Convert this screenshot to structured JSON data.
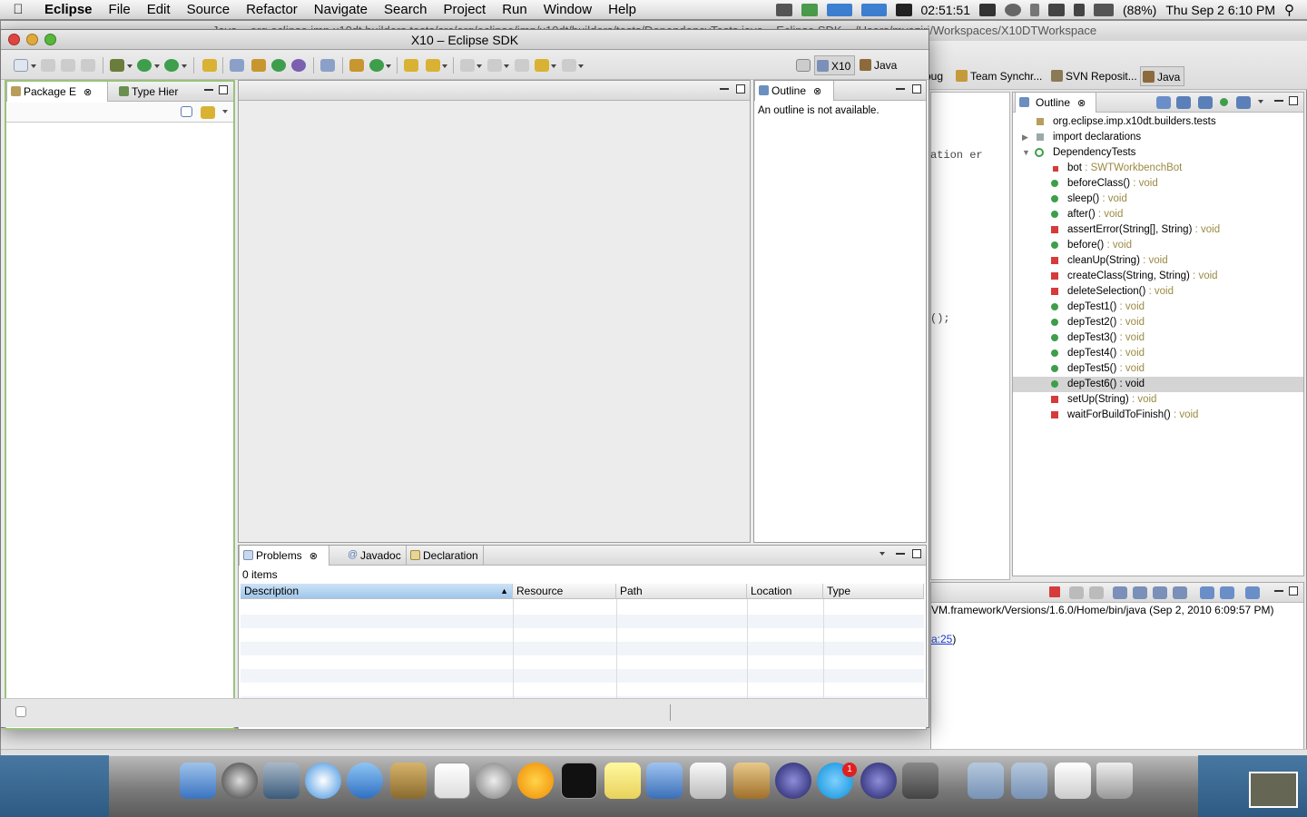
{
  "menubar": {
    "app_name": "Eclipse",
    "items": [
      "File",
      "Edit",
      "Source",
      "Refactor",
      "Navigate",
      "Search",
      "Project",
      "Run",
      "Window",
      "Help"
    ],
    "clock_text": "02:51:51",
    "battery": "(88%)",
    "datetime": "Thu Sep 2  6:10 PM"
  },
  "back_window": {
    "title": "Java – org.eclipse.imp.x10dt.builders.tests/src/org/eclipse/imp/x10dt/builders/tests/DependencyTests.java – Eclipse SDK – /Users/mvaziri/Workspaces/X10DTWorkspace",
    "perspectives": [
      "bug",
      "Team Synchr...",
      "SVN Reposit...",
      "Java"
    ],
    "code_lines": [
      "ation er",
      "();"
    ],
    "outline": {
      "tab": "Outline",
      "items": [
        {
          "label": "org.eclipse.imp.x10dt.builders.tests",
          "type": ""
        },
        {
          "label": "import declarations",
          "type": ""
        },
        {
          "label": "DependencyTests",
          "type": ""
        },
        {
          "label": "bot",
          "type": " : SWTWorkbenchBot"
        },
        {
          "label": "beforeClass()",
          "type": " : void"
        },
        {
          "label": "sleep()",
          "type": " : void"
        },
        {
          "label": "after()",
          "type": " : void"
        },
        {
          "label": "assertError(String[], String)",
          "type": " : void"
        },
        {
          "label": "before()",
          "type": " : void"
        },
        {
          "label": "cleanUp(String)",
          "type": " : void"
        },
        {
          "label": "createClass(String, String)",
          "type": " : void"
        },
        {
          "label": "deleteSelection()",
          "type": " : void"
        },
        {
          "label": "depTest1()",
          "type": " : void"
        },
        {
          "label": "depTest2()",
          "type": " : void"
        },
        {
          "label": "depTest3()",
          "type": " : void"
        },
        {
          "label": "depTest4()",
          "type": " : void"
        },
        {
          "label": "depTest5()",
          "type": " : void"
        },
        {
          "label": "depTest6()",
          "type": " : void"
        },
        {
          "label": "setUp(String)",
          "type": " : void"
        },
        {
          "label": "waitForBuildToFinish()",
          "type": " : void"
        }
      ]
    },
    "console_line1": "VM.framework/Versions/1.6.0/Home/bin/java (Sep 2, 2010 6:09:57 PM)",
    "console_link": "a:25",
    "console_tail": ")"
  },
  "window": {
    "title": "X10 – Eclipse SDK",
    "perspectives": [
      "X10",
      "Java"
    ],
    "package_tabs": [
      "Package E",
      "Type Hier"
    ],
    "outline_tab": "Outline",
    "outline_message": "An outline is not available.",
    "bottom_tabs": [
      "Problems",
      "Javadoc",
      "Declaration"
    ],
    "problems_count": "0 items",
    "columns": [
      "Description",
      "Resource",
      "Path",
      "Location",
      "Type"
    ]
  },
  "colors": {
    "accent": "#3b88d8",
    "selection": "#d4d4d4",
    "method_private": "#d63b3b",
    "method_public": "#3e9e4b"
  }
}
